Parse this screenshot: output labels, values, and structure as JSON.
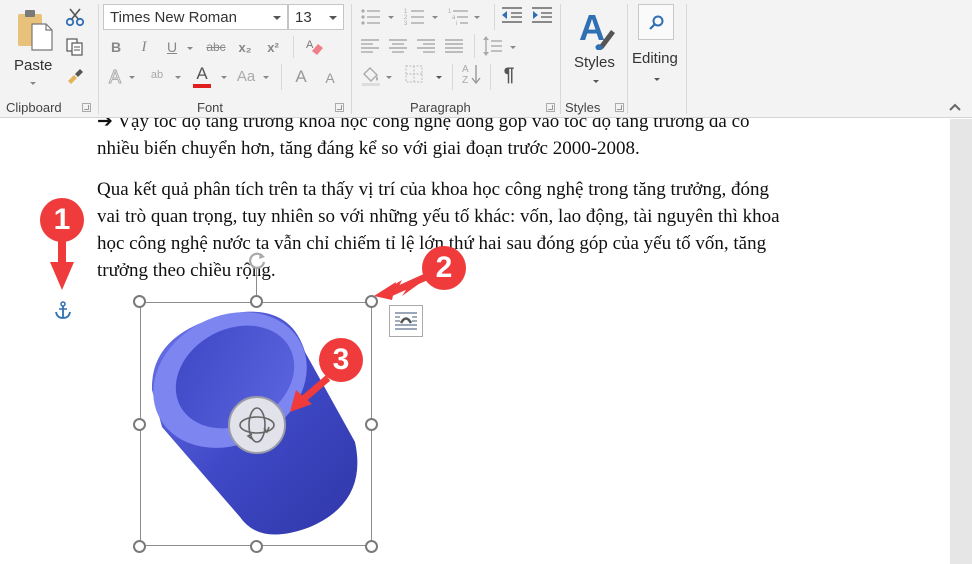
{
  "ribbon": {
    "clipboard": {
      "label": "Clipboard",
      "paste_label": "Paste",
      "icons": [
        "paste-icon",
        "cut-icon",
        "copy-icon",
        "format-painter-icon"
      ]
    },
    "font": {
      "label": "Font",
      "font_name": "Times New Roman",
      "font_size": "13",
      "buttons": {
        "bold": "B",
        "italic": "I",
        "underline": "U",
        "strikethrough": "abc",
        "subscript": "x₂",
        "superscript": "x²",
        "text_effects": "A",
        "highlight": "ab",
        "font_color": "A",
        "change_case": "Aa",
        "grow_font": "A",
        "shrink_font": "A"
      },
      "font_color_hex": "#e01e1e"
    },
    "paragraph": {
      "label": "Paragraph",
      "pilcrow": "¶",
      "sort": "A\nZ"
    },
    "styles": {
      "label": "Styles",
      "button_label": "Styles"
    },
    "editing": {
      "button_label": "Editing"
    },
    "collapse_glyph": "^"
  },
  "document": {
    "paragraphs": [
      {
        "lines": [
          "➔ Vậy tốc độ tăng trưởng khoa học công nghệ đóng góp vào tốc độ tăng trưởng đã có",
          "nhiều biến chuyển hơn, tăng đáng kể so với giai đoạn trước 2000-2008."
        ]
      },
      {
        "lines": [
          "Qua kết quả phân tích trên ta thấy vị trí của khoa học công nghệ trong tăng trưởng, đóng",
          "vai trò quan trọng, tuy nhiên so với những yếu tố khác: vốn, lao động, tài nguyên thì khoa",
          "học công nghệ nước ta vẫn chỉ chiếm tỉ lệ lớn thứ hai sau đóng góp của yếu tố vốn, tăng",
          "trưởng theo chiều rộng."
        ]
      }
    ]
  },
  "annotations": {
    "badge_1": "1",
    "badge_2": "2",
    "badge_3": "3",
    "badge_color": "#ef3b3b"
  },
  "object": {
    "type": "3D model",
    "color": "#4a55d8",
    "icons": [
      "anchor-icon",
      "rotate-icon",
      "layout-options-icon",
      "3d-rotate-icon"
    ]
  }
}
